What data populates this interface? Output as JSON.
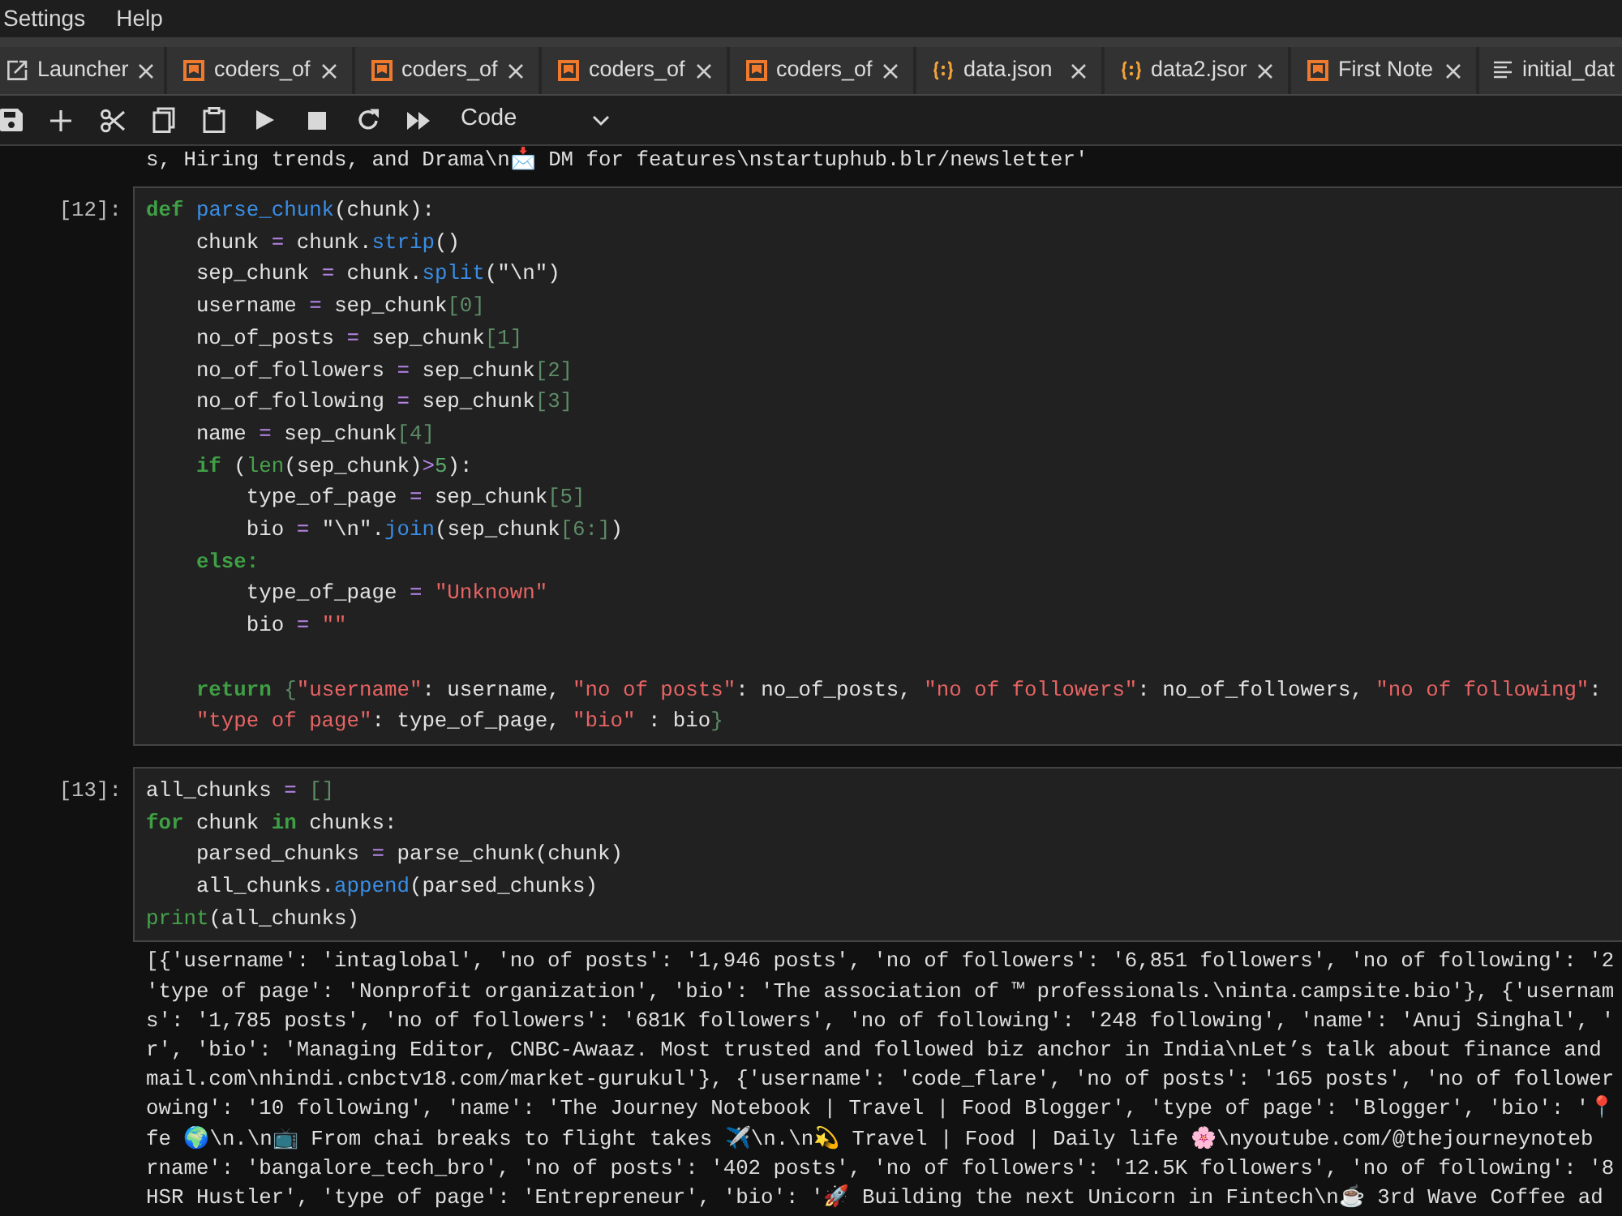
{
  "menu": [
    "Settings",
    "Help"
  ],
  "tabs": [
    {
      "label": "Launcher",
      "kind": "launcher"
    },
    {
      "label": "coders_of",
      "kind": "notebook"
    },
    {
      "label": "coders_of",
      "kind": "notebook"
    },
    {
      "label": "coders_of",
      "kind": "notebook"
    },
    {
      "label": "coders_of",
      "kind": "notebook"
    },
    {
      "label": "data.json",
      "kind": "json"
    },
    {
      "label": "data2.jsor",
      "kind": "json"
    },
    {
      "label": "First Note",
      "kind": "notebook"
    },
    {
      "label": "initial_dat",
      "kind": "text"
    }
  ],
  "toolbar": {
    "cell_type": "Code"
  },
  "notebook": {
    "output_above": [
      "s, Hiring trends, and Drama\\n📩 DM for features\\nstartuphub.blr/newsletter'"
    ],
    "cells": [
      {
        "prompt": "[12]:",
        "lines": [
          {
            "tokens": [
              {
                "kind": "keyword",
                "text": "def"
              },
              {
                "kind": "function",
                "text": " parse_chunk"
              },
              {
                "kind": "plain",
                "text": "(chunk):"
              }
            ]
          },
          {
            "tokens": [
              {
                "kind": "plain",
                "text": "    chunk "
              },
              {
                "kind": "operator",
                "text": "="
              },
              {
                "kind": "plain",
                "text": " chunk."
              },
              {
                "kind": "function",
                "text": "strip"
              },
              {
                "kind": "plain",
                "text": "()"
              }
            ]
          },
          {
            "tokens": [
              {
                "kind": "plain",
                "text": "    sep_chunk "
              },
              {
                "kind": "operator",
                "text": "="
              },
              {
                "kind": "plain",
                "text": " chunk."
              },
              {
                "kind": "function",
                "text": "split"
              },
              {
                "kind": "plain",
                "text": "(\"\\n\")"
              }
            ]
          },
          {
            "tokens": [
              {
                "kind": "plain",
                "text": "    username "
              },
              {
                "kind": "operator",
                "text": "="
              },
              {
                "kind": "plain",
                "text": " sep_chunk"
              },
              {
                "kind": "bracket",
                "text": "[0]"
              }
            ]
          },
          {
            "tokens": [
              {
                "kind": "plain",
                "text": "    no_of_posts "
              },
              {
                "kind": "operator",
                "text": "="
              },
              {
                "kind": "plain",
                "text": " sep_chunk"
              },
              {
                "kind": "bracket",
                "text": "[1]"
              }
            ]
          },
          {
            "tokens": [
              {
                "kind": "plain",
                "text": "    no_of_followers "
              },
              {
                "kind": "operator",
                "text": "="
              },
              {
                "kind": "plain",
                "text": " sep_chunk"
              },
              {
                "kind": "bracket",
                "text": "[2]"
              }
            ]
          },
          {
            "tokens": [
              {
                "kind": "plain",
                "text": "    no_of_following "
              },
              {
                "kind": "operator",
                "text": "="
              },
              {
                "kind": "plain",
                "text": " sep_chunk"
              },
              {
                "kind": "bracket",
                "text": "[3]"
              }
            ]
          },
          {
            "tokens": [
              {
                "kind": "plain",
                "text": "    name "
              },
              {
                "kind": "operator",
                "text": "="
              },
              {
                "kind": "plain",
                "text": " sep_chunk"
              },
              {
                "kind": "bracket",
                "text": "[4]"
              }
            ]
          },
          {
            "tokens": [
              {
                "kind": "keyword",
                "text": "    if"
              },
              {
                "kind": "plain",
                "text": " ("
              },
              {
                "kind": "builtin",
                "text": "len"
              },
              {
                "kind": "plain",
                "text": "(sep_chunk)"
              },
              {
                "kind": "operator",
                "text": ">"
              },
              {
                "kind": "number",
                "text": "5"
              },
              {
                "kind": "plain",
                "text": "):"
              }
            ]
          },
          {
            "tokens": [
              {
                "kind": "plain",
                "text": "        type_of_page "
              },
              {
                "kind": "operator",
                "text": "="
              },
              {
                "kind": "plain",
                "text": " sep_chunk"
              },
              {
                "kind": "bracket",
                "text": "[5]"
              }
            ]
          },
          {
            "tokens": [
              {
                "kind": "plain",
                "text": "        bio "
              },
              {
                "kind": "operator",
                "text": "="
              },
              {
                "kind": "plain",
                "text": " \"\\n\"."
              },
              {
                "kind": "function",
                "text": "join"
              },
              {
                "kind": "plain",
                "text": "(sep_chunk"
              },
              {
                "kind": "bracket",
                "text": "[6:]"
              },
              {
                "kind": "plain",
                "text": ")"
              }
            ]
          },
          {
            "tokens": [
              {
                "kind": "keyword",
                "text": "    else:"
              }
            ]
          },
          {
            "tokens": [
              {
                "kind": "plain",
                "text": "        type_of_page "
              },
              {
                "kind": "operator",
                "text": "="
              },
              {
                "kind": "string",
                "text": " \"Unknown\""
              }
            ]
          },
          {
            "tokens": [
              {
                "kind": "plain",
                "text": "        bio "
              },
              {
                "kind": "operator",
                "text": "="
              },
              {
                "kind": "string",
                "text": " \"\""
              }
            ]
          },
          {
            "kind": "blank"
          },
          {
            "tokens": [
              {
                "kind": "keyword",
                "text": "    return"
              },
              {
                "kind": "bracket",
                "text": " {"
              },
              {
                "kind": "string",
                "text": "\"username\""
              },
              {
                "kind": "plain",
                "text": ": username, "
              },
              {
                "kind": "string",
                "text": "\"no of posts\""
              },
              {
                "kind": "plain",
                "text": ": no_of_posts, "
              },
              {
                "kind": "string",
                "text": "\"no of followers\""
              },
              {
                "kind": "plain",
                "text": ": no_of_followers, "
              },
              {
                "kind": "string",
                "text": "\"no of following\""
              },
              {
                "kind": "plain",
                "text": ":"
              }
            ]
          },
          {
            "tokens": [
              {
                "kind": "string",
                "text": "    \"type of page\""
              },
              {
                "kind": "plain",
                "text": ": type_of_page, "
              },
              {
                "kind": "string",
                "text": "\"bio\""
              },
              {
                "kind": "plain",
                "text": " : bio"
              },
              {
                "kind": "bracket",
                "text": "}"
              }
            ]
          }
        ]
      },
      {
        "prompt": "[13]:",
        "lines": [
          {
            "tokens": [
              {
                "kind": "plain",
                "text": "all_chunks "
              },
              {
                "kind": "operator",
                "text": "="
              },
              {
                "kind": "bracket",
                "text": " []"
              }
            ]
          },
          {
            "tokens": [
              {
                "kind": "keyword",
                "text": "for"
              },
              {
                "kind": "plain",
                "text": " chunk "
              },
              {
                "kind": "keyword",
                "text": "in"
              },
              {
                "kind": "plain",
                "text": " chunks:"
              }
            ]
          },
          {
            "tokens": [
              {
                "kind": "plain",
                "text": "    parsed_chunks "
              },
              {
                "kind": "operator",
                "text": "="
              },
              {
                "kind": "plain",
                "text": " parse_chunk(chunk)"
              }
            ]
          },
          {
            "tokens": [
              {
                "kind": "plain",
                "text": "    all_chunks."
              },
              {
                "kind": "function",
                "text": "append"
              },
              {
                "kind": "plain",
                "text": "(parsed_chunks)"
              }
            ]
          },
          {
            "tokens": [
              {
                "kind": "builtin",
                "text": "print"
              },
              {
                "kind": "plain",
                "text": "(all_chunks)"
              }
            ]
          }
        ],
        "output": [
          "[{'username': 'intaglobal', 'no of posts': '1,946 posts', 'no of followers': '6,851 followers', 'no of following': '2",
          "'type of page': 'Nonprofit organization', 'bio': 'The association of ™ professionals.\\ninta.campsite.bio'}, {'usernam",
          "s': '1,785 posts', 'no of followers': '681K followers', 'no of following': '248 following', 'name': 'Anuj Singhal', '",
          "r', 'bio': 'Managing Editor, CNBC-Awaaz. Most trusted and followed biz anchor in India\\nLet’s talk about finance and",
          "mail.com\\nhindi.cnbctv18.com/market-gurukul'}, {'username': 'code_flare', 'no of posts': '165 posts', 'no of follower",
          "owing': '10 following', 'name': 'The Journey Notebook | Travel | Food Blogger', 'type of page': 'Blogger', 'bio': '📍",
          "fe 🌍\\n.\\n📺 From chai breaks to flight takes ✈️\\n.\\n💫 Travel | Food | Daily life 🌸\\nyoutube.com/@thejourneynoteb",
          "rname': 'bangalore_tech_bro', 'no of posts': '402 posts', 'no of followers': '12.5K followers', 'no of following': '8",
          "HSR Hustler', 'type of page': 'Entrepreneur', 'bio': '🚀 Building the next Unicorn in Fintech\\n☕️ 3rd Wave Coffee ad"
        ]
      }
    ]
  }
}
